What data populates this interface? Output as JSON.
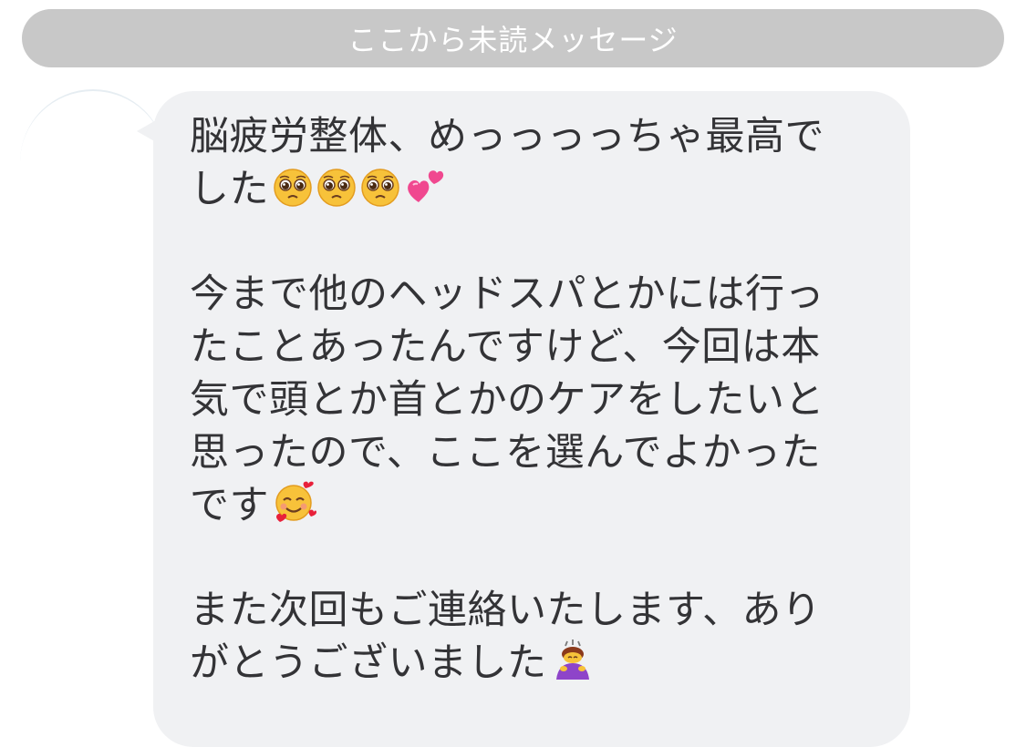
{
  "divider": {
    "label": "ここから未読メッセージ"
  },
  "message": {
    "lines": [
      "脳疲労整体、めっっっっちゃ最高で",
      "した",
      "",
      "今まで他のヘッドスパとかには行っ",
      "たことあったんですけど、今回は本",
      "気で頭とか首とかのケアをしたいと",
      "思ったので、ここを選んでよかった",
      "です",
      "",
      "また次回もご連絡いたします、あり",
      "がとうございました"
    ],
    "emoji": {
      "line2": [
        "pleading-face-icon",
        "pleading-face-icon",
        "pleading-face-icon",
        "two-hearts-icon"
      ],
      "line8": [
        "smiling-face-with-hearts-icon"
      ],
      "line11": [
        "person-bowing-icon"
      ]
    }
  },
  "colors": {
    "bubble": "#f0f1f3",
    "divider": "#c8c8c8",
    "text": "#333336"
  }
}
